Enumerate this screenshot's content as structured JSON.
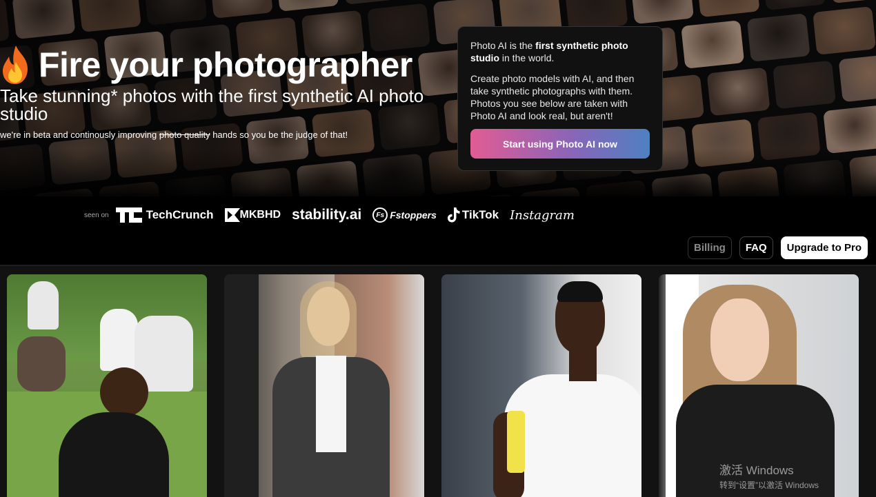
{
  "hero": {
    "title": "Fire your photographer",
    "subtitle": "Take stunning* photos with the first synthetic AI photo studio",
    "note_prefix": "we're in beta and continously improving ",
    "note_strike": "photo quality",
    "note_suffix": " hands so you be the judge of that!"
  },
  "card": {
    "p1_a": "Photo AI is the ",
    "p1_b": "first synthetic photo studio",
    "p1_c": " in the world.",
    "p2": "Create photo models with AI, and then take synthetic photographs with them. Photos you see below are taken with Photo AI and look real, but aren't!",
    "cta": "Start using Photo AI now"
  },
  "press": {
    "seen_on": "seen on",
    "brands": [
      "TechCrunch",
      "MKBHD",
      "stability.ai",
      "Fstoppers",
      "TikTok",
      "Instagram"
    ]
  },
  "nav": {
    "billing": "Billing",
    "faq": "FAQ",
    "upgrade": "Upgrade to Pro"
  },
  "watermark": {
    "line1": "激活 Windows",
    "line2": "转到“设置”以激活 Windows"
  },
  "colors": {
    "cta_start": "#e25c93",
    "cta_end": "#4e80c2",
    "background": "#000000"
  },
  "icons": [
    "fire-icon",
    "techcrunch-logo",
    "mkbhd-logo",
    "fstoppers-logo",
    "tiktok-icon",
    "instagram-logo"
  ]
}
